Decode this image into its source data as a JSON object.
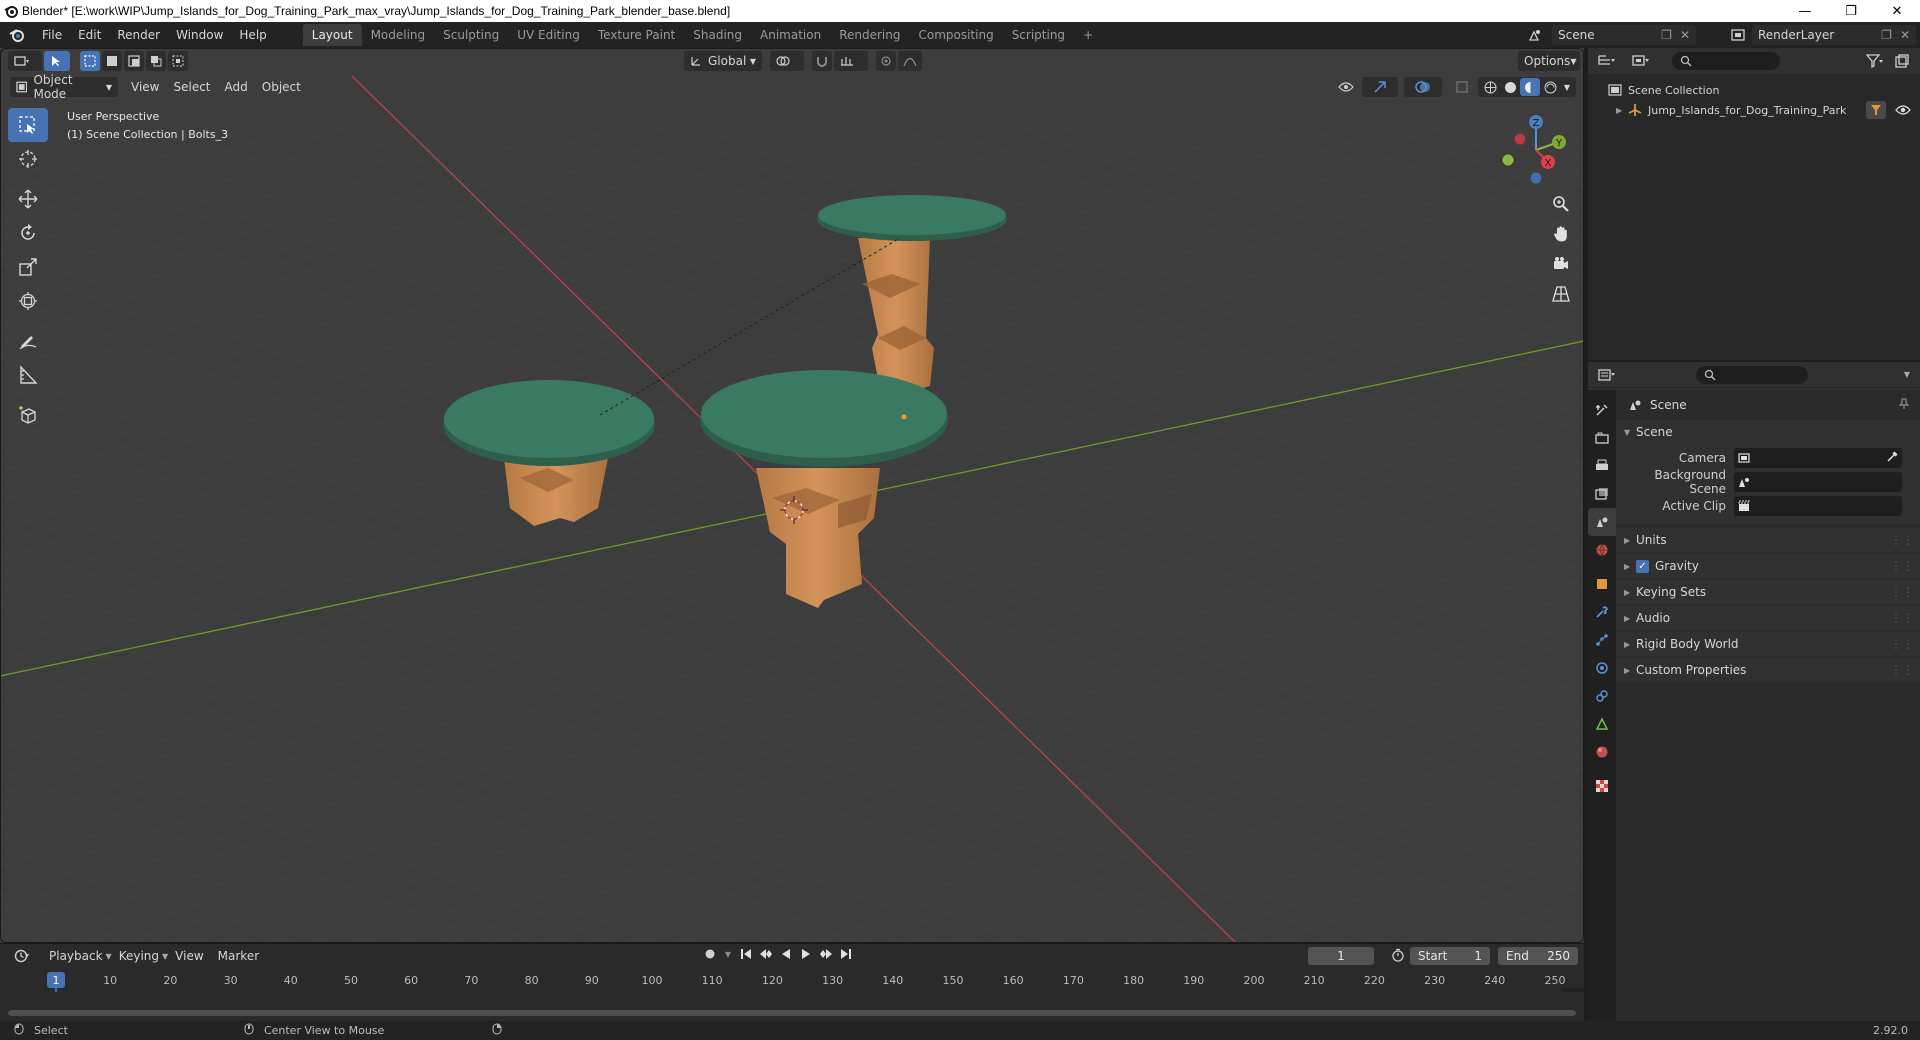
{
  "window": {
    "title": "Blender* [E:\\work\\WIP\\Jump_Islands_for_Dog_Training_Park_max_vray\\Jump_Islands_for_Dog_Training_Park_blender_base.blend]",
    "minimize": "—",
    "maximize": "❐",
    "close": "✕"
  },
  "menu": [
    "File",
    "Edit",
    "Render",
    "Window",
    "Help"
  ],
  "workspaces": [
    "Layout",
    "Modeling",
    "Sculpting",
    "UV Editing",
    "Texture Paint",
    "Shading",
    "Animation",
    "Rendering",
    "Compositing",
    "Scripting"
  ],
  "active_workspace": "Layout",
  "add_workspace": "+",
  "scene_name": "Scene",
  "view_layer": "RenderLayer",
  "viewport": {
    "mode": "Object Mode",
    "menus": [
      "View",
      "Select",
      "Add",
      "Object"
    ],
    "transform_orientation": "Global",
    "options_label": "Options",
    "info_line1": "User Perspective",
    "info_line2": "(1) Scene Collection | Bolts_3",
    "gizmo_axes": {
      "z": "Z",
      "y": "Y",
      "x": "X"
    }
  },
  "tools": [
    "select-box",
    "cursor",
    "move",
    "rotate",
    "scale",
    "transform",
    "annotate",
    "measure",
    "add-cube"
  ],
  "timeline": {
    "menus": [
      "Playback",
      "Keying",
      "View",
      "Marker"
    ],
    "current_frame": "1",
    "start_label": "Start",
    "start_value": "1",
    "end_label": "End",
    "end_value": "250",
    "ruler": [
      "1",
      "10",
      "20",
      "30",
      "40",
      "50",
      "60",
      "70",
      "80",
      "90",
      "100",
      "110",
      "120",
      "130",
      "140",
      "150",
      "160",
      "170",
      "180",
      "190",
      "200",
      "210",
      "220",
      "230",
      "240",
      "250"
    ]
  },
  "statusbar": {
    "left": "Select",
    "middle": "Center View to Mouse",
    "version": "2.92.0"
  },
  "outliner": {
    "root": "Scene Collection",
    "items": [
      {
        "label": "Jump_Islands_for_Dog_Training_Park"
      }
    ]
  },
  "properties": {
    "context": "Scene",
    "panel": "Scene",
    "fields": [
      {
        "label": "Camera",
        "value": ""
      },
      {
        "label": "Background Scene",
        "value": ""
      },
      {
        "label": "Active Clip",
        "value": ""
      }
    ],
    "subpanels": [
      "Units",
      "Gravity",
      "Keying Sets",
      "Audio",
      "Rigid Body World",
      "Custom Properties"
    ],
    "gravity_checked": true
  },
  "colors": {
    "active_blue": "#4772b3",
    "island_top": "#3a7a62",
    "island_post": "#c8874f",
    "x_axis": "#b8414b",
    "y_axis": "#6f9a2b"
  }
}
